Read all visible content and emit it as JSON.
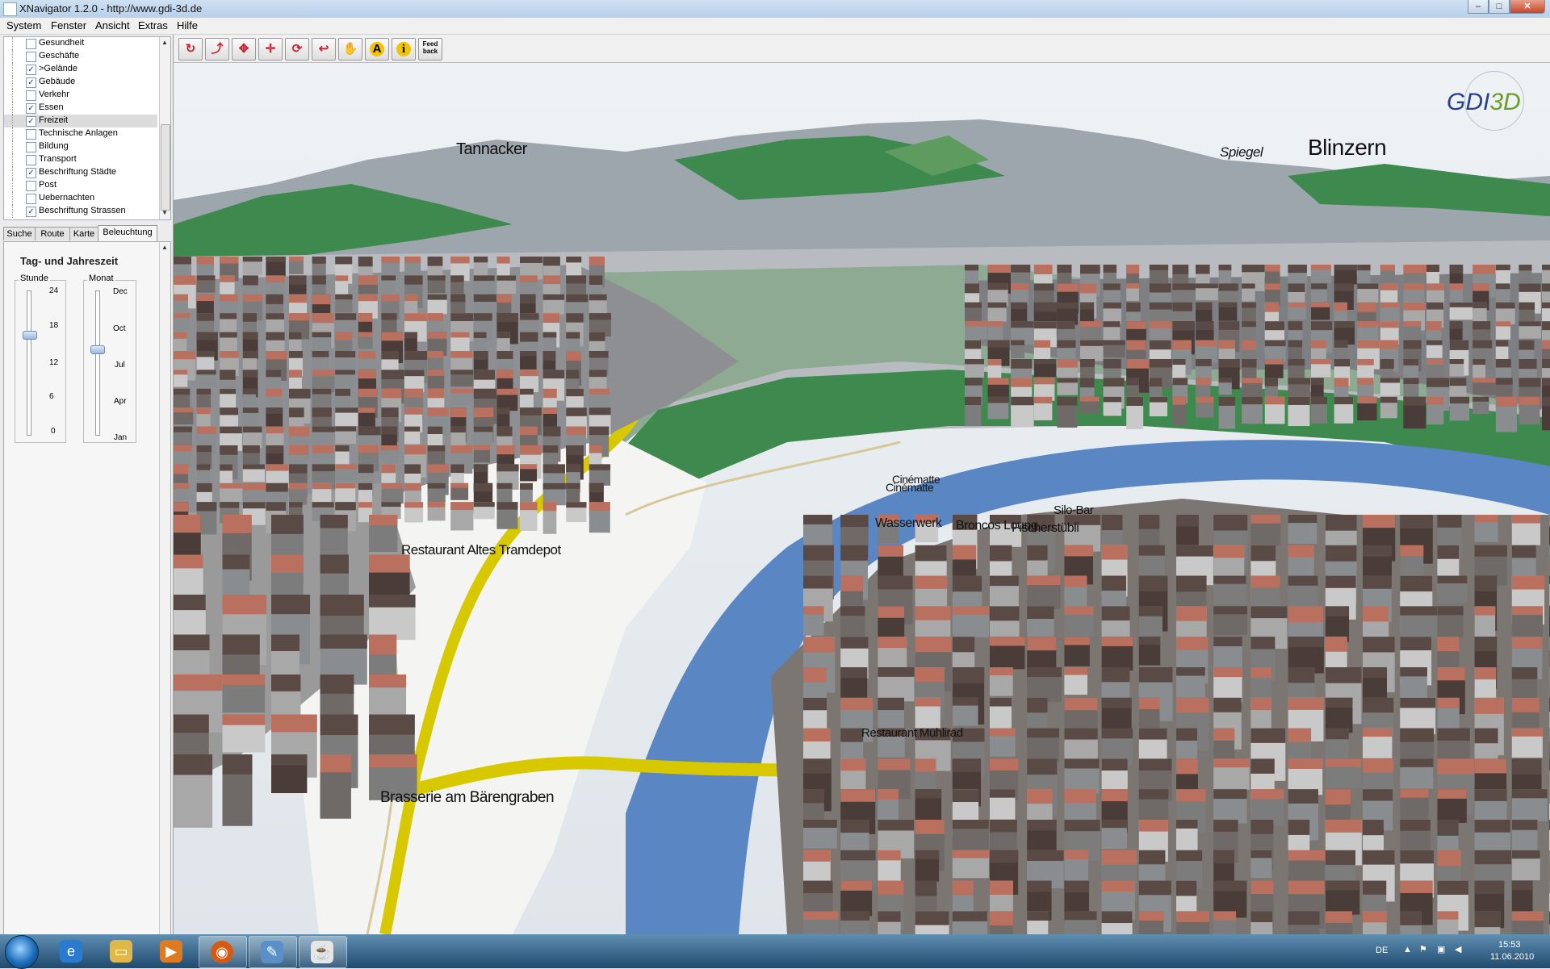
{
  "window": {
    "title": "XNavigator 1.2.0 - http://www.gdi-3d.de",
    "min": "–",
    "max": "□",
    "close": "✕"
  },
  "menu": [
    "System",
    "Fenster",
    "Ansicht",
    "Extras",
    "Hilfe"
  ],
  "layers": [
    {
      "label": "Gesundheit",
      "checked": false
    },
    {
      "label": "Geschäfte",
      "checked": false
    },
    {
      "label": ">Gelände",
      "checked": true
    },
    {
      "label": "Gebäude",
      "checked": true
    },
    {
      "label": "Verkehr",
      "checked": false
    },
    {
      "label": "Essen",
      "checked": true
    },
    {
      "label": "Freizeit",
      "checked": true,
      "selected": true
    },
    {
      "label": "Technische Anlagen",
      "checked": false
    },
    {
      "label": "Bildung",
      "checked": false
    },
    {
      "label": "Transport",
      "checked": false
    },
    {
      "label": "Beschriftung Städte",
      "checked": true
    },
    {
      "label": "Post",
      "checked": false
    },
    {
      "label": "Uebernachten",
      "checked": false
    },
    {
      "label": "Beschriftung Strassen",
      "checked": true
    }
  ],
  "tabs": [
    "Suche",
    "Route",
    "Karte",
    "Beleuchtung"
  ],
  "lighting": {
    "section_title": "Tag- und Jahreszeit",
    "hour": {
      "label": "Stunde",
      "ticks": [
        "24",
        "18",
        "12",
        "6",
        "0"
      ],
      "value": 17
    },
    "month": {
      "label": "Monat",
      "ticks": [
        "Dec",
        "Oct",
        "Jul",
        "Apr",
        "Jan"
      ],
      "value_fraction": 0.6
    }
  },
  "toolbar": {
    "tools": [
      {
        "icon": "rotate-view-icon"
      },
      {
        "icon": "tilt-view-icon"
      },
      {
        "icon": "move-horizontal-icon"
      },
      {
        "icon": "move-vertical-icon"
      },
      {
        "icon": "orbit-icon"
      },
      {
        "icon": "return-icon"
      },
      {
        "icon": "hand-pan-icon"
      },
      {
        "icon": "annotation-icon"
      },
      {
        "icon": "info-icon"
      }
    ],
    "annotation_glyph": "A",
    "info_glyph": "i",
    "feedback_label": "Feed back"
  },
  "map_labels": [
    "Tannacker",
    "Spiegel",
    "Blinzern",
    "Cinématte",
    "Cinématte",
    "Wasserwerk",
    "Broncos Loung",
    "Fischerstübli",
    "Silo-Bar",
    "Restaurant Altes Tramdepot",
    "Restaurant Mühlirad",
    "Brasserie am Bärengraben"
  ],
  "logo": {
    "text_a": "GDI",
    "text_b": "3D"
  },
  "colors": {
    "terrain_green": "#3e8a4e",
    "river_blue": "#5a86c4",
    "road_yellow": "#d8c800",
    "roof_red": "#b9705f"
  },
  "taskbar": {
    "apps": [
      "internet-explorer-icon",
      "explorer-folder-icon",
      "media-player-icon",
      "firefox-icon",
      "paint-icon",
      "java-icon"
    ],
    "lang": "DE",
    "time": "15:53",
    "date": "11.06.2010"
  }
}
